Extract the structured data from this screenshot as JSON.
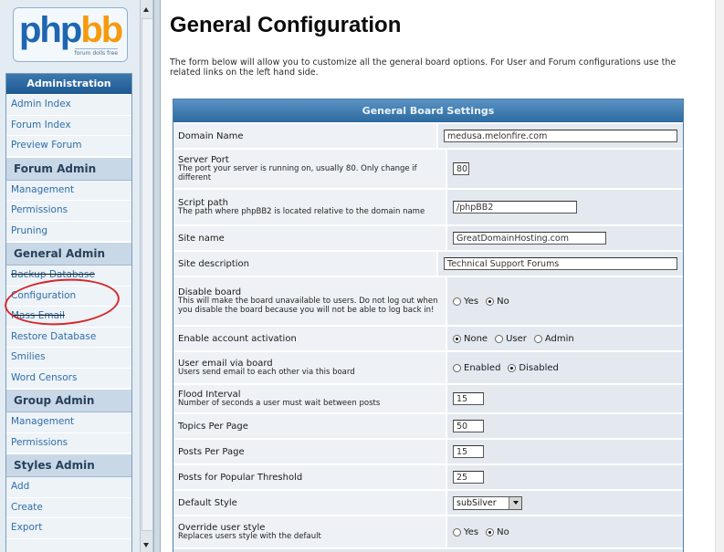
{
  "logo": {
    "part1": "php",
    "part2": "bb",
    "tagline": "forum dolls free"
  },
  "nav": {
    "header": "Administration",
    "top_items": [
      "Admin Index",
      "Forum Index",
      "Preview Forum"
    ],
    "sections": [
      {
        "title": "Forum Admin",
        "items": [
          "Management",
          "Permissions",
          "Pruning"
        ]
      },
      {
        "title": "General Admin",
        "items": [
          "Backup Database",
          "Configuration",
          "Mass Email",
          "Restore Database",
          "Smilies",
          "Word Censors"
        ]
      },
      {
        "title": "Group Admin",
        "items": [
          "Management",
          "Permissions"
        ]
      },
      {
        "title": "Styles Admin",
        "items": [
          "Add",
          "Create",
          "Export"
        ]
      }
    ]
  },
  "page": {
    "title": "General Configuration",
    "description": "The form below will allow you to customize all the general board options. For User and Forum configurations use the related links on the left hand side."
  },
  "settings": {
    "header": "General Board Settings",
    "domain_name": {
      "label": "Domain Name",
      "value": "medusa.melonfire.com"
    },
    "server_port": {
      "label": "Server Port",
      "sub": "The port your server is running on, usually 80. Only change if different",
      "value": "80"
    },
    "script_path": {
      "label": "Script path",
      "sub": "The path where phpBB2 is located relative to the domain name",
      "value": "/phpBB2"
    },
    "site_name": {
      "label": "Site name",
      "value": "GreatDomainHosting.com"
    },
    "site_description": {
      "label": "Site description",
      "value": "Technical Support Forums"
    },
    "disable_board": {
      "label": "Disable board",
      "sub": "This will make the board unavailable to users. Do not log out when you disable the board because you will not be able to log back in!",
      "options": [
        "Yes",
        "No"
      ],
      "selected": "No"
    },
    "account_activation": {
      "label": "Enable account activation",
      "options": [
        "None",
        "User",
        "Admin"
      ],
      "selected": "None"
    },
    "user_email": {
      "label": "User email via board",
      "sub": "Users send email to each other via this board",
      "options": [
        "Enabled",
        "Disabled"
      ],
      "selected": "Disabled"
    },
    "flood_interval": {
      "label": "Flood Interval",
      "sub": "Number of seconds a user must wait between posts",
      "value": "15"
    },
    "topics_per_page": {
      "label": "Topics Per Page",
      "value": "50"
    },
    "posts_per_page": {
      "label": "Posts Per Page",
      "value": "15"
    },
    "popular_threshold": {
      "label": "Posts for Popular Threshold",
      "value": "25"
    },
    "default_style": {
      "label": "Default Style",
      "value": "subSilver"
    },
    "override_style": {
      "label": "Override user style",
      "sub": "Replaces users style with the default",
      "options": [
        "Yes",
        "No"
      ],
      "selected": "No"
    }
  }
}
